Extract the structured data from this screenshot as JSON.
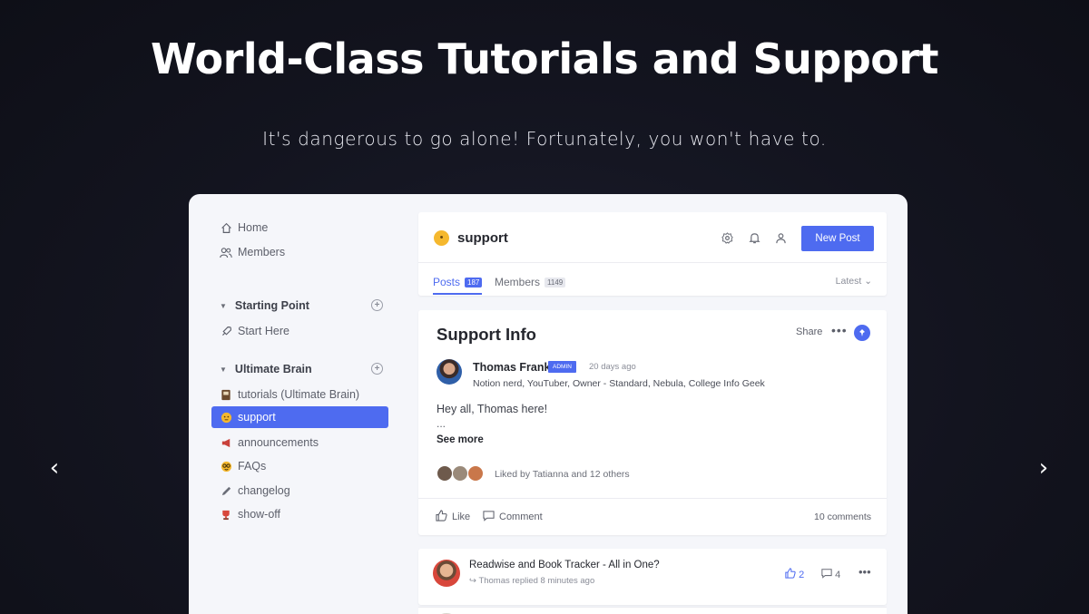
{
  "hero": {
    "title": "World-Class Tutorials and Support",
    "subtitle": "It's dangerous to go alone! Fortunately, you won't have to."
  },
  "carousel": {
    "prev_icon": "‹",
    "next_icon": "›"
  },
  "sidebar": {
    "top_items": [
      {
        "label": "Home",
        "icon": "home-icon"
      },
      {
        "label": "Members",
        "icon": "members-icon"
      }
    ],
    "sections": [
      {
        "title": "Starting Point",
        "items": [
          {
            "label": "Start Here",
            "icon": "rocket-icon"
          }
        ]
      },
      {
        "title": "Ultimate Brain",
        "items": [
          {
            "label": "tutorials (Ultimate Brain)",
            "icon": "book-icon"
          },
          {
            "label": "support",
            "icon": "thinking-face-icon",
            "active": true
          },
          {
            "label": "announcements",
            "icon": "megaphone-icon"
          },
          {
            "label": "FAQs",
            "icon": "nerd-face-icon"
          },
          {
            "label": "changelog",
            "icon": "pencil-icon"
          },
          {
            "label": "show-off",
            "icon": "trophy-icon"
          }
        ]
      }
    ]
  },
  "channel": {
    "name": "support",
    "new_post_label": "New Post",
    "tabs": [
      {
        "label": "Posts",
        "count": "187",
        "active": true
      },
      {
        "label": "Members",
        "count": "1149"
      }
    ],
    "sort_label": "Latest"
  },
  "post": {
    "title": "Support Info",
    "share_label": "Share",
    "more_label": "•••",
    "author": {
      "name": "Thomas Frank",
      "badge": "ADMIN",
      "time": "20 days ago",
      "bio": "Notion nerd, YouTuber, Owner - Standard, Nebula, College Info Geek"
    },
    "body": "Hey all, Thomas here!",
    "ellipsis": "...",
    "see_more": "See more",
    "liked_by": "Liked by Tatianna and 12 others",
    "like_label": "Like",
    "comment_label": "Comment",
    "comment_count": "10 comments"
  },
  "thread": {
    "title": "Readwise and Book Tracker - All in One?",
    "meta": "Thomas replied 8 minutes ago",
    "likes": "2",
    "comments": "4",
    "more_label": "•••"
  },
  "colors": {
    "accent": "#4e6bf0",
    "background": "#13141f",
    "panel": "#f5f6fa"
  }
}
